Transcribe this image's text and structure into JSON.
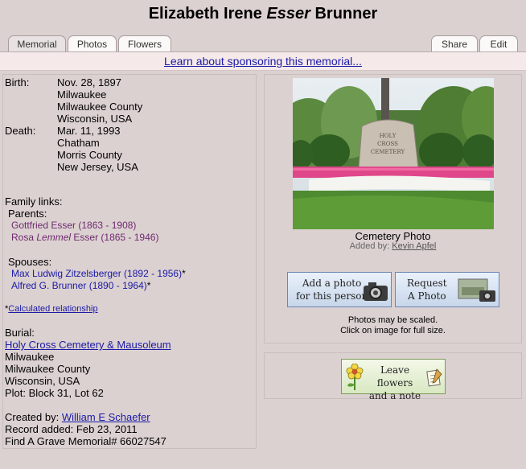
{
  "title": {
    "first": "Elizabeth Irene",
    "maiden": "Esser",
    "last": "Brunner"
  },
  "tabs": {
    "memorial": "Memorial",
    "photos": "Photos",
    "flowers": "Flowers",
    "share": "Share",
    "edit": "Edit"
  },
  "sponsor_link": "Learn about sponsoring this memorial...",
  "birth": {
    "label": "Birth:",
    "date": "Nov. 28, 1897",
    "place": [
      "Milwaukee",
      "Milwaukee County",
      "Wisconsin, USA"
    ]
  },
  "death": {
    "label": "Death:",
    "date": "Mar. 11, 1993",
    "place": [
      "Chatham",
      "Morris County",
      "New Jersey, USA"
    ]
  },
  "family": {
    "heading": "Family links:",
    "parents_label": "Parents:",
    "parents": [
      {
        "name": "Gottfried Esser (1863 - 1908)"
      },
      {
        "first": "Rosa",
        "maiden": "Lemmel",
        "rest": "Esser (1865 - 1946)"
      }
    ],
    "spouses_label": "Spouses:",
    "spouses": [
      {
        "name": "Max Ludwig Zitzelsberger (1892 - 1956)",
        "mark": "*"
      },
      {
        "name": "Alfred G. Brunner (1890 - 1964)",
        "mark": "*"
      }
    ],
    "calc_star": "*",
    "calc_link": "Calculated relationship"
  },
  "burial": {
    "label": "Burial:",
    "cemetery": "Holy Cross Cemetery & Mausoleum",
    "lines": [
      "Milwaukee",
      "Milwaukee County",
      "Wisconsin, USA"
    ],
    "plot": "Plot: Block 31, Lot 62"
  },
  "record": {
    "created_label": "Created by:",
    "created_by": "William E Schaefer",
    "added": "Record added: Feb 23, 2011",
    "memorial_id": "Find A Grave Memorial# 66027547"
  },
  "photo": {
    "sign_text": [
      "HOLY",
      "CROSS",
      "CEMETERY"
    ],
    "caption": "Cemetery Photo",
    "added_by_label": "Added by:",
    "added_by": "Kevin Apfel"
  },
  "buttons": {
    "add_photo": [
      "Add a photo",
      "for this person"
    ],
    "request_photo": [
      "Request",
      "A Photo"
    ],
    "flowers": [
      "Leave flowers",
      "and a note"
    ]
  },
  "notes": [
    "Photos may be scaled.",
    "Click on image for full size."
  ]
}
